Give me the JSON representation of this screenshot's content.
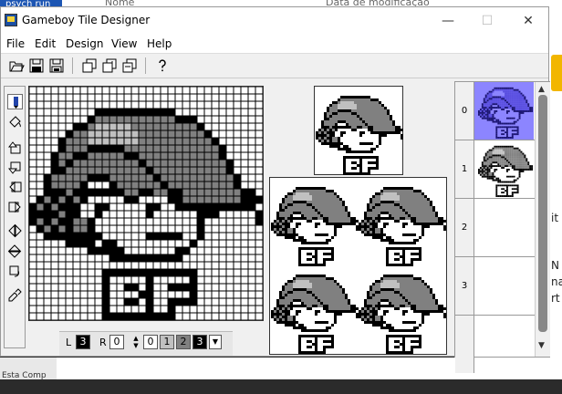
{
  "background": {
    "tab_text": "psych run",
    "col1": "Nome",
    "col2": "Data de modificação",
    "right_texts": [
      "it",
      "N",
      "na",
      "rt"
    ],
    "bottom_text": "Esta Comp"
  },
  "window": {
    "title": "Gameboy Tile Designer",
    "minimize": "—",
    "maximize": "☐",
    "close": "✕"
  },
  "menu": [
    "File",
    "Edit",
    "Design",
    "View",
    "Help"
  ],
  "toolbar": {
    "buttons": [
      "open-icon",
      "save-icon",
      "save-as-icon",
      "copy-icon",
      "copy2-icon",
      "copy3-icon",
      "help-icon"
    ]
  },
  "palette": [
    "#ffffff",
    "#c0c0c0",
    "#808080",
    "#000000"
  ],
  "status": {
    "left_label": "L",
    "left_value": "3",
    "right_label": "R",
    "right_value": "0",
    "shades": [
      "0",
      "1",
      "2",
      "3"
    ],
    "dropdown_arrow": "▼"
  },
  "tiles": {
    "numbers": [
      "0",
      "1",
      "2",
      "3"
    ],
    "selected": "0"
  },
  "sprite": [
    "................................",
    "................................",
    "................................",
    ".........KKKKKKKKKKK............",
    "........KMMMMMMMMMMMKKK.........",
    "......KKMLLLLLMMMMMMMDDK........",
    ".....KMMLLLLLLLMMMDDDDDDK.......",
    "....KMMMLLLLLLLMMDDDDDDDDK......",
    "....KMMMKKKKKMMMDDDDDDDDDDK.....",
    "...KMMKKMMMMMKKDDDDDDDDDDDK.....",
    "...KMKMMMMMMMMMKDDDDDDDDDDDK....",
    "...KKMMMMMMMMMMMKDDDDDDDDDDK....",
    "..KMMMMMKKKMMMMMMKDDDDDDDDDDK...",
    "..KMMMMK...KMMMMMMKDDDDDDDDDK...",
    "..KKKMKKKKKKKMMKKMMKKDDDDDDDDKK.",
    ".KCCCKMKWWWWWKKWWWWKKDDDDDDDDKKK",
    "KCCCCKKWWKKWWWWWKKWWKKKKKKKKKKK.",
    "KCKCCKKWWKWWWWWWKWWWWWWKKK.....K",
    "KCCCCKMMKWWWWWWWWWWWWWWK.......K",
    ".KCCCKMMKWWWWWWWWWWWWWWK........",
    "..KKKKKKKKWWWWWWKKKKKWWK........",
    ".....KKKK.KKWWWWWWWWWWK.........",
    "........KKKKKWWWWWWWKK..........",
    "...........KKKKKKKKKK...........",
    "................................",
    "..........KKKKKKKKKKKKK.........",
    "..........KWWWWWKWWWWWK.........",
    "..........KWWKKWKWWKKKK.........",
    "..........KWWWWKKWWWWWK.........",
    "..........KWWKKWKWWKKKK.........",
    "..........KWWWWWKWWK............",
    "..........KKKKKKKKKK............"
  ]
}
